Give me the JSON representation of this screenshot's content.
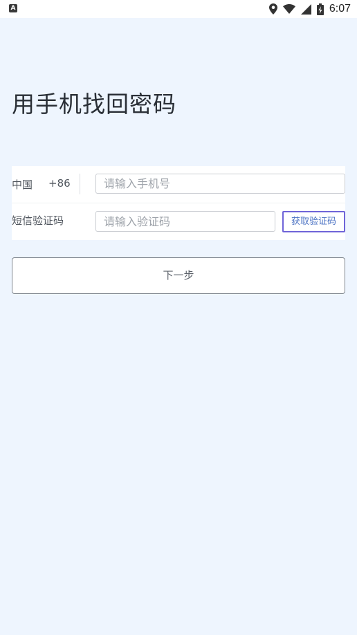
{
  "status_bar": {
    "left_icon_glyph": "A",
    "time": "6:07",
    "icons": [
      "location-icon",
      "wifi-icon",
      "signal-icon",
      "battery-charging-icon"
    ]
  },
  "page": {
    "title": "用手机找回密码"
  },
  "form": {
    "country_label": "中国",
    "country_code": "+86",
    "phone_placeholder": "请输入手机号",
    "phone_value": "",
    "code_label": "短信验证码",
    "code_placeholder": "请输入验证码",
    "code_value": "",
    "get_code_label": "获取验证码"
  },
  "actions": {
    "next_label": "下一步"
  },
  "colors": {
    "background": "#eef5fe",
    "get_code_border": "#6f64d8",
    "get_code_text": "#4c73c4"
  }
}
